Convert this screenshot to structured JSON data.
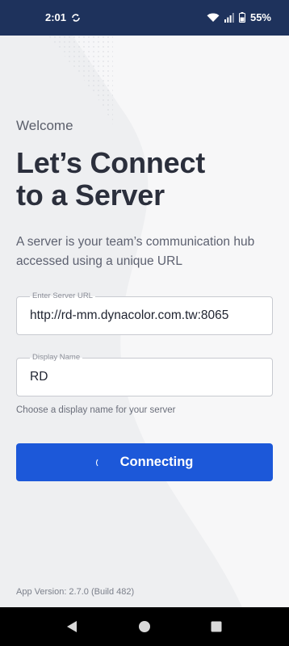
{
  "status_bar": {
    "time": "2:01",
    "battery": "55%",
    "icons": [
      "sync-icon",
      "wifi-icon",
      "signal-icon",
      "battery-icon"
    ]
  },
  "welcome": {
    "eyebrow": "Welcome",
    "headline_line1": "Let’s Connect",
    "headline_line2": "to a Server",
    "description": "A server is your team’s communication hub accessed using a unique URL"
  },
  "server_url": {
    "label": "Enter Server URL",
    "value": "http://rd-mm.dynacolor.com.tw:8065"
  },
  "display_name": {
    "label": "Display Name",
    "value": "RD",
    "help": "Choose a display name for your server"
  },
  "connect_button": {
    "label": "Connecting"
  },
  "footer": {
    "app_version": "App Version: 2.7.0 (Build 482)"
  },
  "colors": {
    "status_bar": "#1e325c",
    "primary_button": "#1c58d9",
    "background": "#eeeff1",
    "nav_bar": "#000000"
  }
}
